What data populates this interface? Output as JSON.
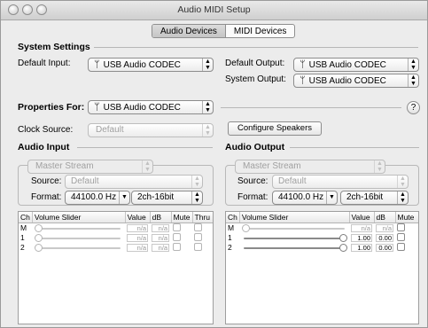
{
  "window": {
    "title": "Audio MIDI Setup"
  },
  "tabs": [
    {
      "label": "Audio Devices",
      "selected": true
    },
    {
      "label": "MIDI Devices",
      "selected": false
    }
  ],
  "system_settings": {
    "heading": "System Settings",
    "default_input_label": "Default Input:",
    "default_input_value": "USB Audio CODEC",
    "default_output_label": "Default Output:",
    "default_output_value": "USB Audio CODEC",
    "system_output_label": "System Output:",
    "system_output_value": "USB Audio CODEC"
  },
  "properties": {
    "label": "Properties For:",
    "value": "USB Audio CODEC",
    "help": "?",
    "clock_source_label": "Clock Source:",
    "clock_source_value": "Default",
    "configure_speakers": "Configure Speakers"
  },
  "audio_input": {
    "heading": "Audio Input",
    "stream": "Master Stream",
    "source_label": "Source:",
    "source_value": "Default",
    "format_label": "Format:",
    "rate": "44100.0 Hz",
    "bits": "2ch-16bit",
    "columns": [
      "Ch",
      "Volume Slider",
      "Value",
      "dB",
      "Mute",
      "Thru"
    ],
    "rows": [
      {
        "ch": "M",
        "value": "n/a",
        "db": "n/a",
        "level": 0
      },
      {
        "ch": "1",
        "value": "n/a",
        "db": "n/a",
        "level": 0
      },
      {
        "ch": "2",
        "value": "n/a",
        "db": "n/a",
        "level": 0
      }
    ]
  },
  "audio_output": {
    "heading": "Audio Output",
    "stream": "Master Stream",
    "source_label": "Source:",
    "source_value": "Default",
    "format_label": "Format:",
    "rate": "44100.0 Hz",
    "bits": "2ch-16bit",
    "columns": [
      "Ch",
      "Volume Slider",
      "Value",
      "dB",
      "Mute"
    ],
    "rows": [
      {
        "ch": "M",
        "value": "n/a",
        "db": "n/a",
        "level": 0
      },
      {
        "ch": "1",
        "value": "1.00",
        "db": "0.00",
        "level": 1
      },
      {
        "ch": "2",
        "value": "1.00",
        "db": "0.00",
        "level": 1
      }
    ]
  },
  "icons": {
    "device": "usb-icon",
    "popup": "up-down-arrows-icon"
  }
}
